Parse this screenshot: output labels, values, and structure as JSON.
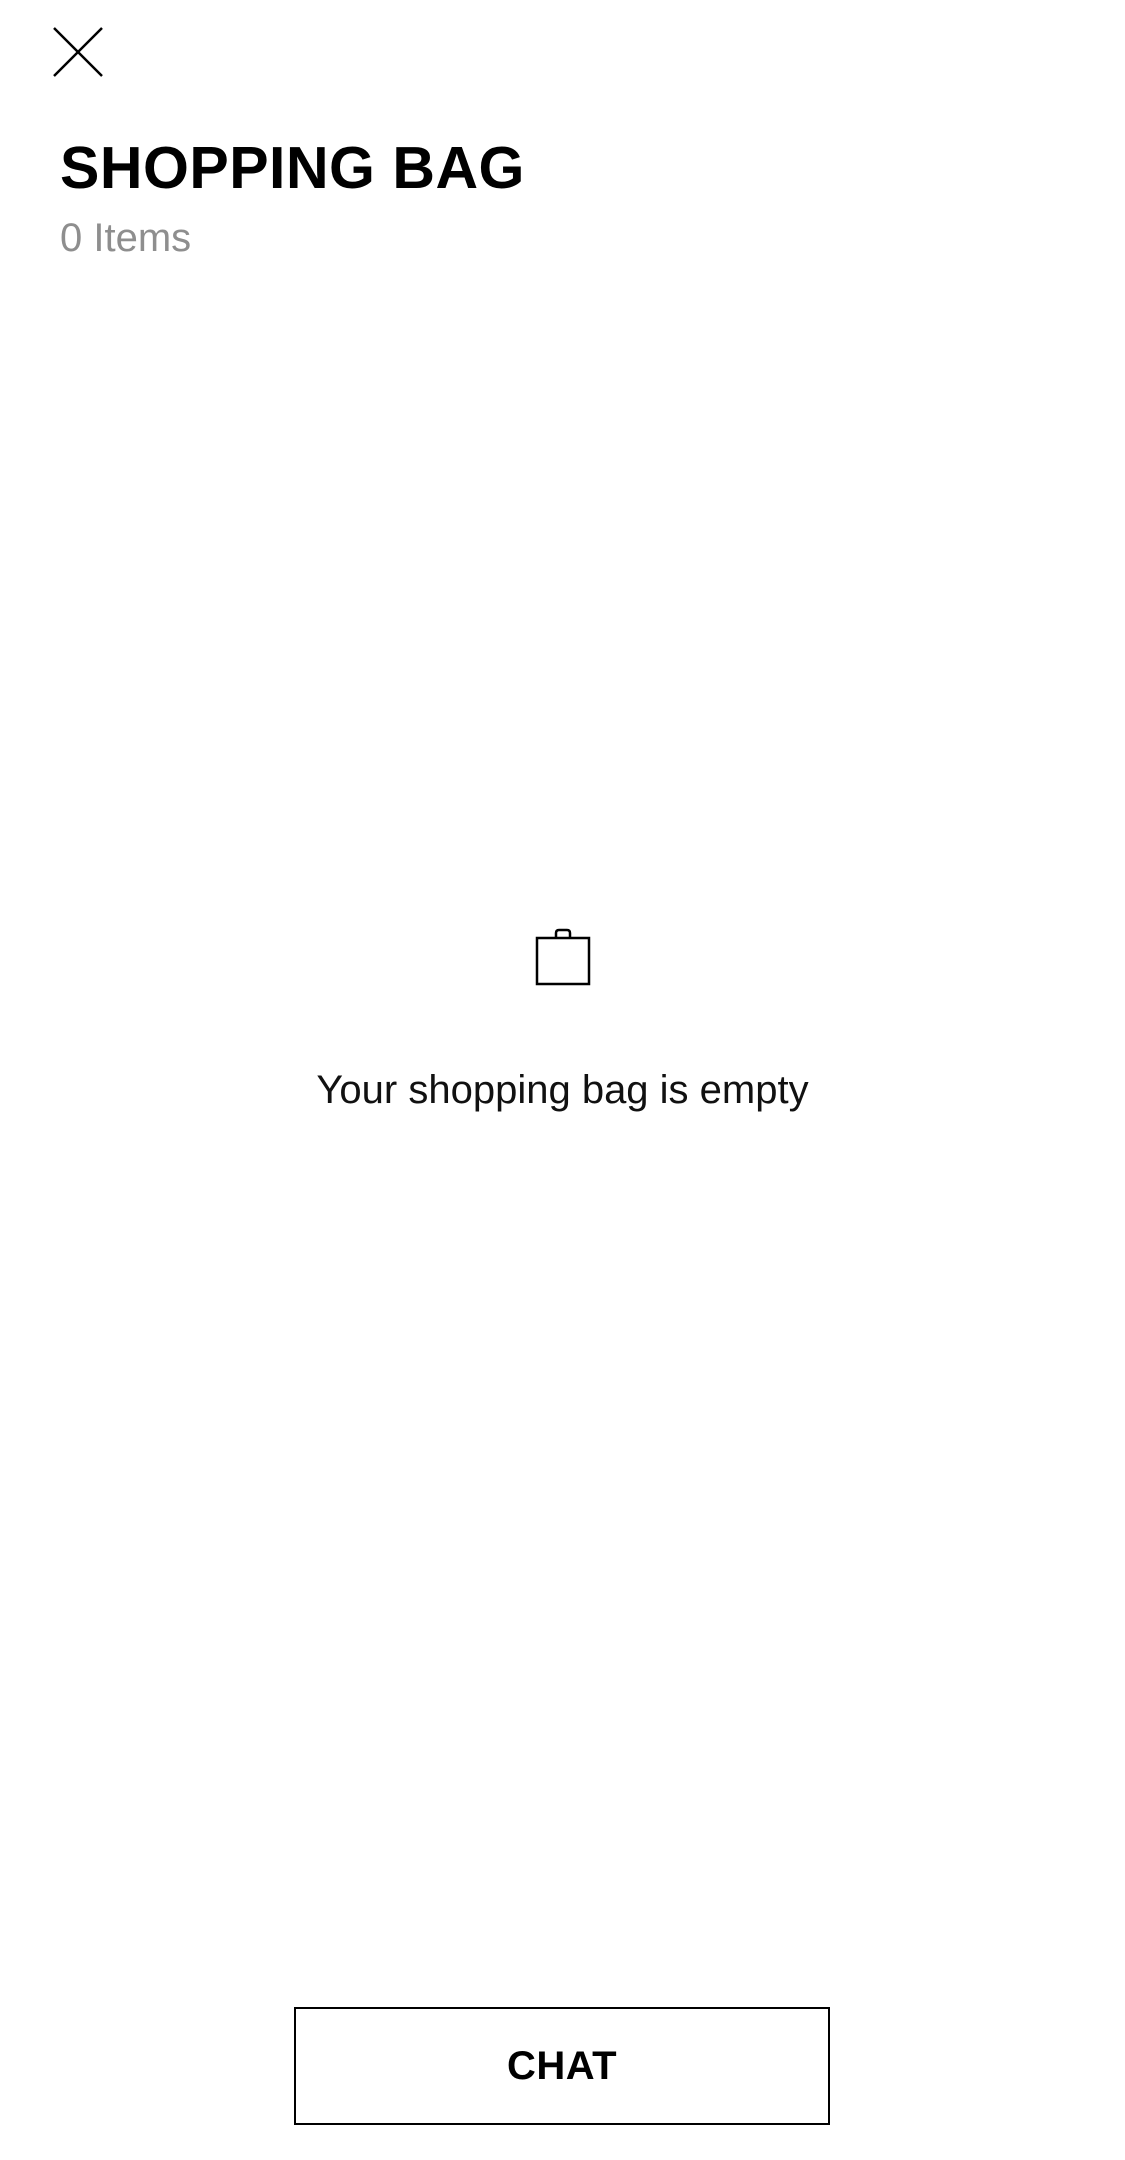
{
  "header": {
    "close_icon": "close-icon",
    "title": "SHOPPING BAG",
    "item_count": "0 Items"
  },
  "empty_state": {
    "icon": "shopping-bag-icon",
    "message": "Your shopping bag is empty"
  },
  "footer": {
    "chat_label": "CHAT"
  },
  "colors": {
    "background": "#ffffff",
    "text": "#000000",
    "muted_text": "#8e8e8e"
  }
}
